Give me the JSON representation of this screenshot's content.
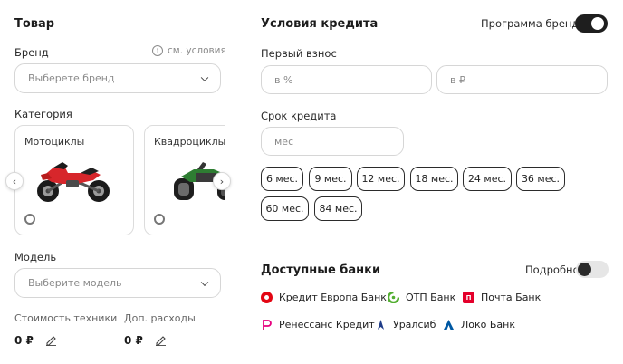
{
  "product": {
    "title": "Товар",
    "brand_label": "Бренд",
    "see_conditions": "см. условия",
    "brand_placeholder": "Выберете бренд",
    "category_label": "Категория",
    "categories": [
      {
        "label": "Мотоциклы"
      },
      {
        "label": "Квадроциклы"
      }
    ],
    "model_label": "Модель",
    "model_placeholder": "Выберите модель",
    "cost_label": "Стоимость техники",
    "cost_value": "0 ₽",
    "extra_label": "Доп. расходы",
    "extra_value": "0 ₽"
  },
  "credit": {
    "title": "Условия кредита",
    "brand_program_label": "Программа бренда",
    "brand_program_on": true,
    "down_payment_label": "Первый взнос",
    "down_payment_percent_placeholder": "в %",
    "down_payment_rub_placeholder": "в ₽",
    "term_label": "Срок кредита",
    "term_placeholder": "мес",
    "term_chips": [
      "6 мес.",
      "9 мес.",
      "12 мес.",
      "18 мес.",
      "24 мес.",
      "36 мес.",
      "60 мес.",
      "84 мес."
    ]
  },
  "banks": {
    "title": "Доступные банки",
    "details_label": "Подробно",
    "details_on": false,
    "items": [
      {
        "name": "Кредит Европа Банк",
        "color": "#e30613"
      },
      {
        "name": "ОТП Банк",
        "color": "#52ae30"
      },
      {
        "name": "Почта Банк",
        "color": "#e4002b"
      },
      {
        "name": "Ренессанс Кредит",
        "color": "#e6007e"
      },
      {
        "name": "Уралсиб",
        "color": "#1f3c88"
      },
      {
        "name": "Локо Банк",
        "color": "#0058a3"
      }
    ]
  },
  "colors": {
    "toggle_on": "#1e1e1e",
    "toggle_off": "#e6e6e6"
  }
}
